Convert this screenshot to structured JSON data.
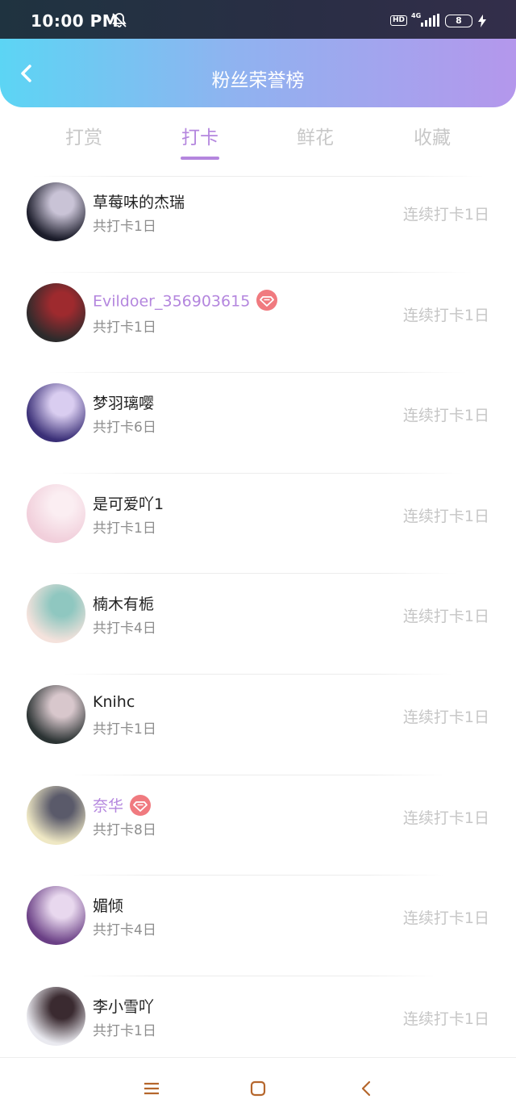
{
  "status_bar": {
    "time": "10:00 PM",
    "hd": "HD",
    "network": "4G",
    "battery": "8"
  },
  "header": {
    "title": "粉丝荣誉榜"
  },
  "tabs": [
    {
      "label": "打赏",
      "active": false
    },
    {
      "label": "打卡",
      "active": true
    },
    {
      "label": "鲜花",
      "active": false
    },
    {
      "label": "收藏",
      "active": false
    }
  ],
  "fans": [
    {
      "name": "草莓味的杰瑞",
      "total": "共打卡1日",
      "streak": "连续打卡1日",
      "vip": false,
      "avatar_colors": [
        "#1b1c2a",
        "#c9c3d6"
      ]
    },
    {
      "name": "Evildoer_356903615",
      "total": "共打卡1日",
      "streak": "连续打卡1日",
      "vip": true,
      "avatar_colors": [
        "#2d2b2c",
        "#9e2a2e"
      ]
    },
    {
      "name": "梦羽璃嘤",
      "total": "共打卡6日",
      "streak": "连续打卡1日",
      "vip": false,
      "avatar_colors": [
        "#3a2f77",
        "#d9cdf0"
      ]
    },
    {
      "name": "是可爱吖1",
      "total": "共打卡1日",
      "streak": "连续打卡1日",
      "vip": false,
      "avatar_colors": [
        "#f1cfdb",
        "#fbeef2"
      ]
    },
    {
      "name": "楠木有栀",
      "total": "共打卡4日",
      "streak": "连续打卡1日",
      "vip": false,
      "avatar_colors": [
        "#f4e2dc",
        "#8fc7c0"
      ]
    },
    {
      "name": "Knihc",
      "total": "共打卡1日",
      "streak": "连续打卡1日",
      "vip": false,
      "avatar_colors": [
        "#2b3333",
        "#d8c7cc"
      ]
    },
    {
      "name": "奈华",
      "total": "共打卡8日",
      "streak": "连续打卡1日",
      "vip": true,
      "avatar_colors": [
        "#efe8c4",
        "#5a5a6a"
      ]
    },
    {
      "name": "媚倾",
      "total": "共打卡4日",
      "streak": "连续打卡1日",
      "vip": false,
      "avatar_colors": [
        "#6a3f85",
        "#e8d8ee"
      ]
    },
    {
      "name": "李小雪吖",
      "total": "共打卡1日",
      "streak": "连续打卡1日",
      "vip": false,
      "avatar_colors": [
        "#eaeaf0",
        "#3a2a30"
      ]
    }
  ],
  "colors": {
    "accent": "#b486de",
    "vip_badge": "#f07a7f",
    "header_from": "#5cd5f4",
    "header_to": "#b497ec"
  }
}
